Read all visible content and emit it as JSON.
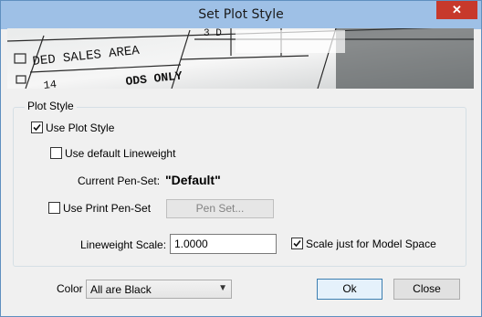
{
  "window": {
    "title": "Set Plot Style",
    "close_glyph": "✕"
  },
  "banner": {
    "line1": "DED SALES AREA",
    "line2": "ODS ONLY",
    "line3": "14",
    "line4": "3 D"
  },
  "plot_style": {
    "group_label": "Plot Style",
    "use_plot_style": {
      "label": "Use Plot Style",
      "checked": true
    },
    "use_default_lineweight": {
      "label": "Use default Lineweight",
      "checked": false
    },
    "current_pen_set_label": "Current Pen-Set:",
    "current_pen_set_value": "\"Default\"",
    "use_print_pen_set": {
      "label": "Use Print Pen-Set",
      "checked": false
    },
    "pen_set_button": "Pen Set...",
    "lineweight_scale_label": "Lineweight Scale:",
    "lineweight_scale_value": "1.0000",
    "scale_model_space": {
      "label": "Scale just for Model Space",
      "checked": true
    }
  },
  "footer": {
    "color_label": "Color",
    "color_selected": "All are Black",
    "ok_label": "Ok",
    "close_label": "Close"
  },
  "icons": {
    "check": "check-icon",
    "dropdown": "chevron-down-icon",
    "close": "close-icon"
  }
}
